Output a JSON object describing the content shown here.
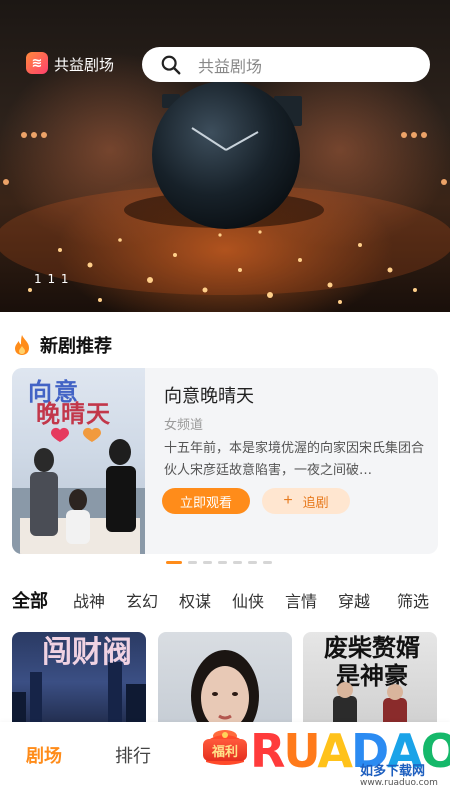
{
  "app": {
    "name": "共益剧场",
    "logo_glyph": "≋"
  },
  "search": {
    "placeholder": "共益剧场"
  },
  "banner": {
    "index_text": "1 1 1"
  },
  "section": {
    "title": "新剧推荐"
  },
  "featured": {
    "title": "向意晚晴天",
    "channel": "女频道",
    "description": "十五年前，本是家境优渥的向家因宋氏集团合伙人宋彦廷故意陷害，一夜之间破…",
    "poster_title_line1": "向意",
    "poster_title_line2": "晚晴天",
    "watch_label": "立即观看",
    "follow_label": "追剧",
    "follow_icon": "+"
  },
  "carousel": {
    "total": 7,
    "active_index": 0
  },
  "categories": [
    "全部",
    "战神",
    "玄幻",
    "权谋",
    "仙侠",
    "言情",
    "穿越",
    "筛选"
  ],
  "thumbnails": [
    {
      "text": "闯财阀"
    },
    {
      "text": ""
    },
    {
      "text_line1": "废柴赘婿",
      "text_line2": "是神豪"
    }
  ],
  "bottom_nav": {
    "theater": "剧场",
    "ranking": "排行",
    "welfare": "福利"
  },
  "watermark": {
    "letters": [
      "R",
      "U",
      "A",
      "D",
      "A",
      "O"
    ],
    "cn": "如多下载网",
    "url": "www.ruaduo.com"
  },
  "colors": {
    "accent": "#ff8c1a",
    "accent_light": "#ffe6d0"
  }
}
